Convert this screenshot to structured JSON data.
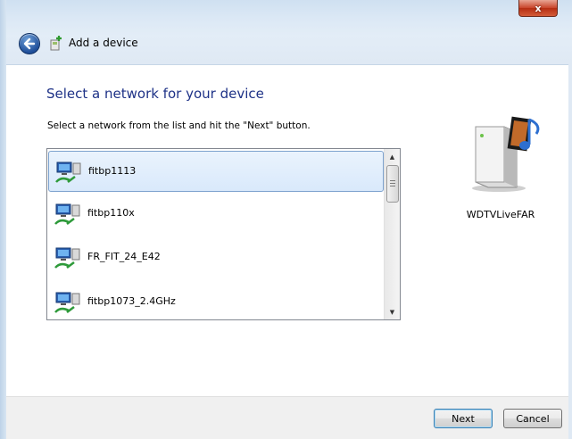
{
  "window": {
    "close_label": "x",
    "title": "Add a device"
  },
  "main": {
    "heading": "Select a network for your device",
    "instruction": "Select a network from the list and hit the \"Next\" button.",
    "networks": [
      {
        "name": "fitbp1113",
        "selected": true
      },
      {
        "name": "fitbp110x",
        "selected": false
      },
      {
        "name": "FR_FIT_24_E42",
        "selected": false
      },
      {
        "name": "fitbp1073_2.4GHz",
        "selected": false
      }
    ],
    "scroll": {
      "up": "▲",
      "down": "▼"
    }
  },
  "device": {
    "name": "WDTVLiveFAR",
    "icon": "media-player-device-icon"
  },
  "footer": {
    "next_label": "Next",
    "cancel_label": "Cancel"
  },
  "colors": {
    "heading": "#1e3287",
    "selection": "#d9e9fb",
    "close": "#c8442a"
  }
}
